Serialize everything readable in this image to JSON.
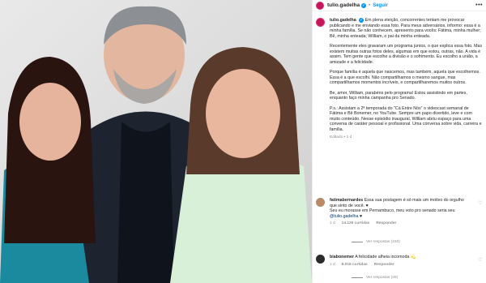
{
  "post": {
    "username": "tulio.gadelha",
    "follow_label": "Seguir",
    "separator": "•",
    "more_label": "•••"
  },
  "caption": {
    "username": "tulio.gadelha",
    "paragraphs": [
      "Em plena eleição, concorrentes tentam me provocar publicando e me enviando essa foto. Para meus adversários, informo: essa é a minha família. Se não conhecem, apresento para vocês: Fátima, minha mulher; Bê, minha enteada; William, o pai da minha enteada.",
      "Recentemente eles gravaram um programa juntos, o que explica essa foto. Mas existem muitas outras fotos deles, algumas em que estou, outras, não. A vida é assim. Tem gente que escolhe a divisão e o sofrimento. Eu escolho a união, a amizade e a felicidade.",
      "Porque família é aquela que nascemos, mas também, aquela que escolhemos. Essa é a que escolhi. Não compartilhamos o mesmo sangue, mas compartilhamos momentos incríveis, e compartilharemos muitos outros.",
      "Be, amor, William, parabéns pelo programa! Estou assistindo em partes, enquanto faço minha campanha pro Senado.",
      "P.s.: Assistam a 2ª temporada do \"Cá Entre Nós\" o videocast semanal de Fátima e Bê Bonemer, no YouTube. Sempre um papo divertido, leve e com muito conteúdo. Nesse episódio inaugural, William abriu espaço para uma conversa de caráter pessoal e profissional. Uma conversa sobre vida, carreira e família."
    ],
    "edited_label": "Editado",
    "time": "1 d"
  },
  "comments": [
    {
      "username": "fatimabernardes",
      "text_1": "Essa sua postagem é só mais um motivo do orgulho que sinto de você. ♥",
      "text_2": "Seu eu morasse em Pernambuco, meu voto pro senado seria seu",
      "mention": "@tulio.gadelha",
      "text_3": "♥",
      "time": "1 d",
      "likes": "14.125 curtidas",
      "reply_label": "Responder",
      "view_replies": "Ver respostas (150)"
    },
    {
      "username": "biabonemer",
      "text_1": "A felicidade alheia incomoda 💫",
      "time": "1 d",
      "likes": "8.016 curtidas",
      "reply_label": "Responder",
      "view_replies": "Ver respostas (29)"
    }
  ],
  "colors": {
    "accent_link": "#0095f6",
    "mention": "#00376b",
    "muted": "#8e8e8e"
  }
}
